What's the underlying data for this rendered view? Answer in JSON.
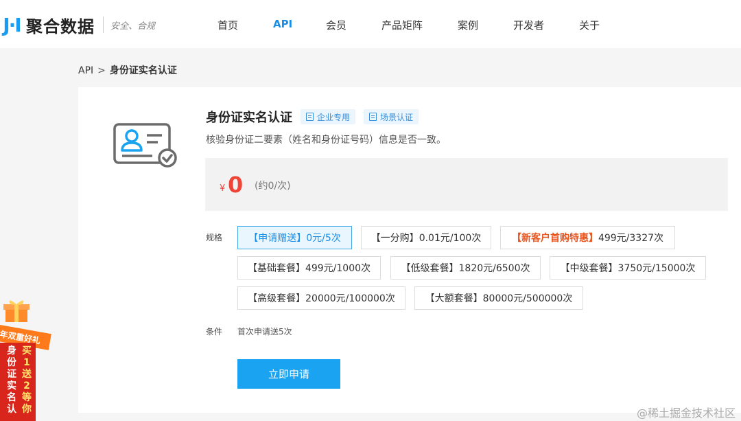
{
  "header": {
    "logo_mark": "J·I",
    "logo_text": "聚合数据",
    "slogan": "安全、合规",
    "nav": [
      {
        "label": "首页",
        "active": false
      },
      {
        "label": "API",
        "active": true
      },
      {
        "label": "会员",
        "active": false
      },
      {
        "label": "产品矩阵",
        "active": false
      },
      {
        "label": "案例",
        "active": false
      },
      {
        "label": "开发者",
        "active": false
      },
      {
        "label": "关于",
        "active": false
      }
    ]
  },
  "breadcrumb": {
    "root": "API",
    "separator": ">",
    "current": "身份证实名认证"
  },
  "product": {
    "icon": "id-card-verified-icon",
    "title": "身份证实名认证",
    "tags": [
      {
        "label": "企业专用",
        "icon": "enterprise-doc-icon"
      },
      {
        "label": "场景认证",
        "icon": "scene-doc-icon"
      }
    ],
    "description": "核验身份证二要素（姓名和身份证号码）信息是否一致。",
    "currency": "¥",
    "price": "0",
    "price_note": "(约0/次)"
  },
  "spec": {
    "label": "规格",
    "options": [
      {
        "tag": "【申请赠送】",
        "price": "0元/5次",
        "selected": true,
        "highlight": false
      },
      {
        "tag": "【一分购】",
        "price": "0.01元/100次",
        "selected": false,
        "highlight": false
      },
      {
        "tag": "【新客户首购特惠】",
        "price": "499元/3327次",
        "selected": false,
        "highlight": true
      },
      {
        "tag": "【基础套餐】",
        "price": "499元/1000次",
        "selected": false,
        "highlight": false
      },
      {
        "tag": "【低级套餐】",
        "price": "1820元/6500次",
        "selected": false,
        "highlight": false
      },
      {
        "tag": "【中级套餐】",
        "price": "3750元/15000次",
        "selected": false,
        "highlight": false
      },
      {
        "tag": "【高级套餐】",
        "price": "20000元/100000次",
        "selected": false,
        "highlight": false
      },
      {
        "tag": "【大额套餐】",
        "price": "80000元/500000次",
        "selected": false,
        "highlight": false
      }
    ]
  },
  "condition": {
    "label": "条件",
    "text": "首次申请送5次"
  },
  "apply_button": "立即申请",
  "promo": {
    "banner": "年双重好礼",
    "col1": "身份证实名认",
    "col2": "买1送2等你"
  },
  "watermark": "@稀土掘金技术社区",
  "colors": {
    "accent": "#1a8ee6",
    "button": "#1aa3f0",
    "price": "#f04438",
    "highlight": "#e8541e",
    "promo": "#d9261c"
  }
}
